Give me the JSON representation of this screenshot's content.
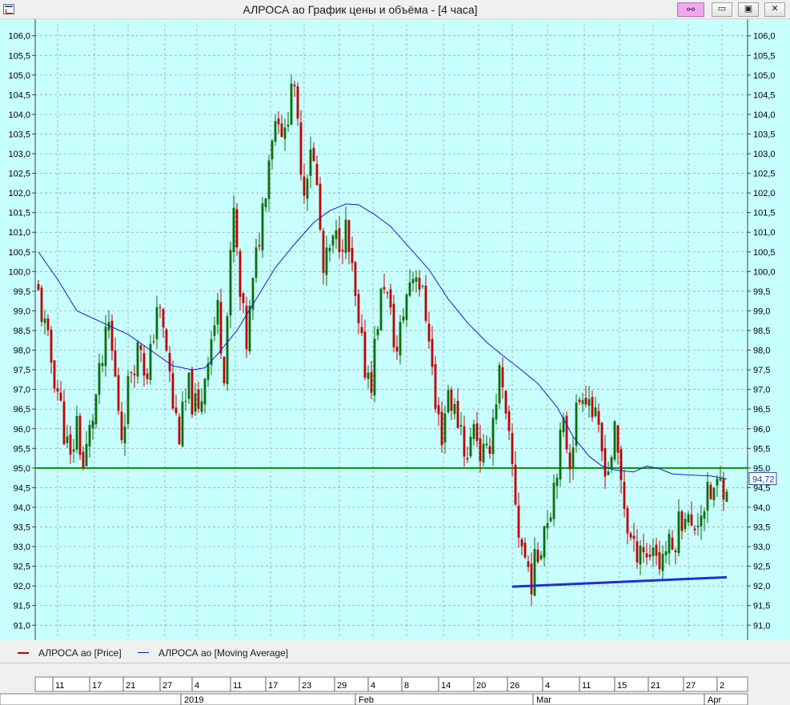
{
  "window": {
    "title": "АЛРОСА ао График цены и объёма - [4 часа]",
    "link_glyph": "⚯",
    "minimize_glyph": "▭",
    "restore_glyph": "▣",
    "close_glyph": "✕"
  },
  "colors": {
    "background": "#c8ffff",
    "up_candle": "#0a6e0a",
    "down_candle": "#c00000",
    "moving_average": "#1a1acc",
    "support_level": "#0a8a0a",
    "trendline": "#1f2fd0",
    "grid": "#9a9a9a"
  },
  "chart_data": {
    "type": "candlestick",
    "series": [
      {
        "name": "АЛРОСА ао [Price]",
        "role": "price"
      },
      {
        "name": "АЛРОСА ао [Moving Average]",
        "role": "moving_average"
      }
    ],
    "ylim": [
      90.7,
      106.3
    ],
    "y_ticks": [
      "91,0",
      "91,5",
      "92,0",
      "92,5",
      "93,0",
      "93,5",
      "94,0",
      "94,5",
      "95,0",
      "95,5",
      "96,0",
      "96,5",
      "97,0",
      "97,5",
      "98,0",
      "98,5",
      "99,0",
      "99,5",
      "100,0",
      "100,5",
      "101,0",
      "101,5",
      "102,0",
      "102,5",
      "103,0",
      "103,5",
      "104,0",
      "104,5",
      "105,0",
      "105,5",
      "106,0"
    ],
    "x_day_ticks": [
      "11",
      "17",
      "21",
      "27",
      "4",
      "11",
      "17",
      "23",
      "29",
      "4",
      "8",
      "14",
      "20",
      "26",
      "4",
      "11",
      "15",
      "21",
      "27",
      "2"
    ],
    "x_month_labels": [
      "2019",
      "Feb",
      "Mar",
      "Apr"
    ],
    "horizontal_level": {
      "value": 95.0
    },
    "trendline": {
      "from": {
        "bar": 148,
        "value": 91.98
      },
      "to": {
        "bar": 215,
        "value": 92.22
      }
    },
    "last_price_label": "94,72",
    "last_price": 94.72,
    "bar_count": 216,
    "price_anchors": [
      [
        0,
        99.4
      ],
      [
        3,
        98.1
      ],
      [
        6,
        97.0
      ],
      [
        8,
        96.0
      ],
      [
        10,
        95.1
      ],
      [
        12,
        96.2
      ],
      [
        14,
        95.0
      ],
      [
        18,
        96.8
      ],
      [
        22,
        98.6
      ],
      [
        26,
        95.9
      ],
      [
        29,
        97.6
      ],
      [
        32,
        98.2
      ],
      [
        34,
        97.1
      ],
      [
        37,
        99.2
      ],
      [
        40,
        98.0
      ],
      [
        42,
        96.6
      ],
      [
        44,
        95.9
      ],
      [
        47,
        97.0
      ],
      [
        50,
        96.3
      ],
      [
        53,
        98.0
      ],
      [
        56,
        99.0
      ],
      [
        58,
        97.6
      ],
      [
        61,
        101.5
      ],
      [
        63,
        99.3
      ],
      [
        65,
        98.2
      ],
      [
        68,
        100.3
      ],
      [
        71,
        102.3
      ],
      [
        73,
        103.6
      ],
      [
        75,
        104.1
      ],
      [
        77,
        103.3
      ],
      [
        79,
        105.0
      ],
      [
        81,
        103.6
      ],
      [
        83,
        102.1
      ],
      [
        85,
        103.3
      ],
      [
        87,
        102.1
      ],
      [
        89,
        99.9
      ],
      [
        91,
        100.5
      ],
      [
        94,
        100.9
      ],
      [
        96,
        101.0
      ],
      [
        98,
        99.9
      ],
      [
        100,
        98.4
      ],
      [
        102,
        97.6
      ],
      [
        104,
        97.3
      ],
      [
        106,
        98.8
      ],
      [
        108,
        99.8
      ],
      [
        110,
        98.8
      ],
      [
        112,
        97.9
      ],
      [
        114,
        99.0
      ],
      [
        116,
        99.8
      ],
      [
        118,
        100.1
      ],
      [
        120,
        99.3
      ],
      [
        122,
        98.5
      ],
      [
        124,
        96.5
      ],
      [
        126,
        95.9
      ],
      [
        128,
        97.0
      ],
      [
        130,
        96.4
      ],
      [
        132,
        96.1
      ],
      [
        134,
        95.1
      ],
      [
        136,
        96.3
      ],
      [
        138,
        95.4
      ],
      [
        140,
        95.2
      ],
      [
        142,
        96.3
      ],
      [
        144,
        97.4
      ],
      [
        146,
        96.1
      ],
      [
        148,
        95.0
      ],
      [
        150,
        93.4
      ],
      [
        152,
        92.7
      ],
      [
        154,
        92.2
      ],
      [
        156,
        92.8
      ],
      [
        158,
        93.6
      ],
      [
        160,
        94.1
      ],
      [
        162,
        95.2
      ],
      [
        164,
        96.0
      ],
      [
        166,
        95.3
      ],
      [
        168,
        96.4
      ],
      [
        170,
        97.1
      ],
      [
        172,
        96.8
      ],
      [
        174,
        96.1
      ],
      [
        176,
        95.4
      ],
      [
        178,
        95.0
      ],
      [
        180,
        95.8
      ],
      [
        182,
        94.7
      ],
      [
        184,
        93.5
      ],
      [
        186,
        92.8
      ],
      [
        188,
        93.2
      ],
      [
        190,
        92.7
      ],
      [
        192,
        93.1
      ],
      [
        194,
        92.6
      ],
      [
        196,
        93.0
      ],
      [
        198,
        92.9
      ],
      [
        200,
        93.6
      ],
      [
        202,
        94.0
      ],
      [
        204,
        93.3
      ],
      [
        206,
        93.8
      ],
      [
        208,
        94.1
      ],
      [
        210,
        94.3
      ],
      [
        212,
        94.5
      ],
      [
        215,
        94.72
      ]
    ],
    "ma_anchors": [
      [
        0,
        100.5
      ],
      [
        6,
        99.8
      ],
      [
        12,
        99.0
      ],
      [
        20,
        98.7
      ],
      [
        28,
        98.4
      ],
      [
        35,
        98.0
      ],
      [
        42,
        97.6
      ],
      [
        48,
        97.5
      ],
      [
        52,
        97.55
      ],
      [
        56,
        97.9
      ],
      [
        62,
        98.5
      ],
      [
        68,
        99.3
      ],
      [
        74,
        100.1
      ],
      [
        80,
        100.7
      ],
      [
        86,
        101.25
      ],
      [
        91,
        101.55
      ],
      [
        96,
        101.72
      ],
      [
        100,
        101.7
      ],
      [
        105,
        101.45
      ],
      [
        110,
        101.15
      ],
      [
        116,
        100.6
      ],
      [
        122,
        100.05
      ],
      [
        128,
        99.3
      ],
      [
        134,
        98.7
      ],
      [
        140,
        98.2
      ],
      [
        146,
        97.8
      ],
      [
        150,
        97.55
      ],
      [
        156,
        97.15
      ],
      [
        162,
        96.55
      ],
      [
        167,
        95.8
      ],
      [
        172,
        95.3
      ],
      [
        176,
        95.05
      ],
      [
        180,
        94.95
      ],
      [
        186,
        94.9
      ],
      [
        190,
        95.05
      ],
      [
        194,
        94.98
      ],
      [
        198,
        94.85
      ],
      [
        204,
        94.82
      ],
      [
        210,
        94.8
      ],
      [
        215,
        94.72
      ]
    ]
  }
}
